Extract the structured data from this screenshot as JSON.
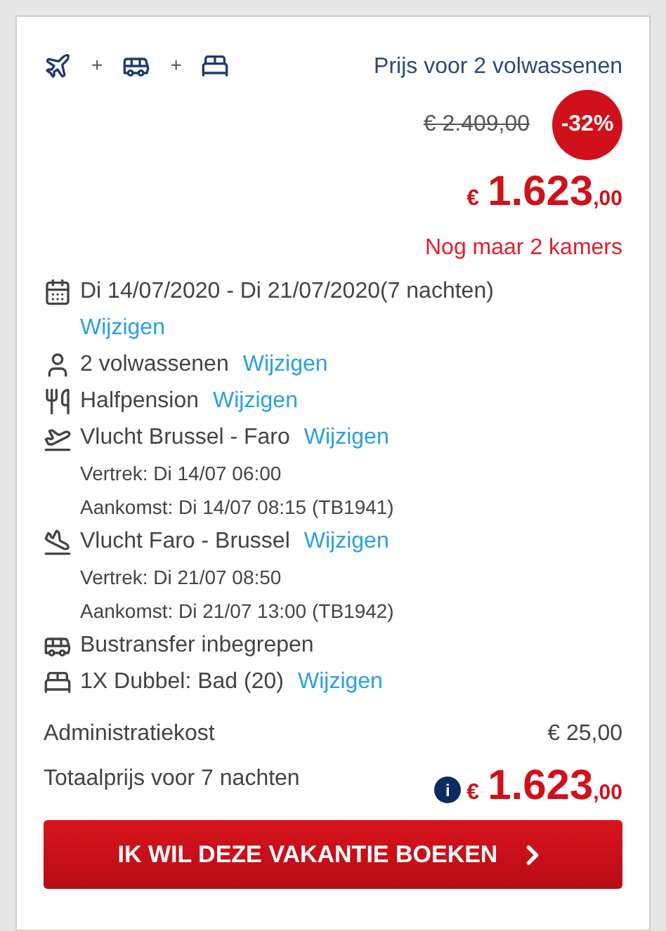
{
  "header": {
    "icons": [
      {
        "kind": "plane"
      },
      {
        "kind": "plus",
        "text": "+"
      },
      {
        "kind": "bus"
      },
      {
        "kind": "plus",
        "text": "+"
      },
      {
        "kind": "bed"
      }
    ],
    "price_label": "Prijs voor 2 volwassenen",
    "old_price": "€ 2.409,00",
    "discount": "-32%",
    "price": {
      "currency": "€",
      "amount": "1.623",
      "cents": ",00"
    },
    "availability": "Nog maar 2 kamers"
  },
  "details": [
    {
      "kind": "calendar",
      "text": "Di 14/07/2020 - Di 21/07/2020(7 nachten)",
      "link": "Wijzigen"
    },
    {
      "kind": "person",
      "text": "2 volwassenen",
      "link": "Wijzigen"
    },
    {
      "kind": "cutlery",
      "text": "Halfpension",
      "link": "Wijzigen"
    },
    {
      "kind": "takeoff",
      "text": "Vlucht Brussel - Faro",
      "link": "Wijzigen",
      "lines": [
        "Vertrek: Di 14/07 06:00",
        "Aankomst: Di 14/07 08:15 (TB1941)"
      ]
    },
    {
      "kind": "landing",
      "text": "Vlucht Faro - Brussel",
      "link": "Wijzigen",
      "lines": [
        "Vertrek: Di 21/07 08:50",
        "Aankomst: Di 21/07 13:00 (TB1942)"
      ]
    },
    {
      "kind": "bus",
      "text": "Bustransfer inbegrepen"
    },
    {
      "kind": "bed",
      "text": "1X Dubbel: Bad (20)",
      "link": "Wijzigen"
    }
  ],
  "admin": {
    "label": "Administratiekost",
    "value": "€ 25,00"
  },
  "total": {
    "label": "Totaalprijs voor 7 nachten",
    "info": "i",
    "currency": "€",
    "amount": "1.623",
    "cents": ",00"
  },
  "book_button": "IK WIL DEZE VAKANTIE BOEKEN"
}
